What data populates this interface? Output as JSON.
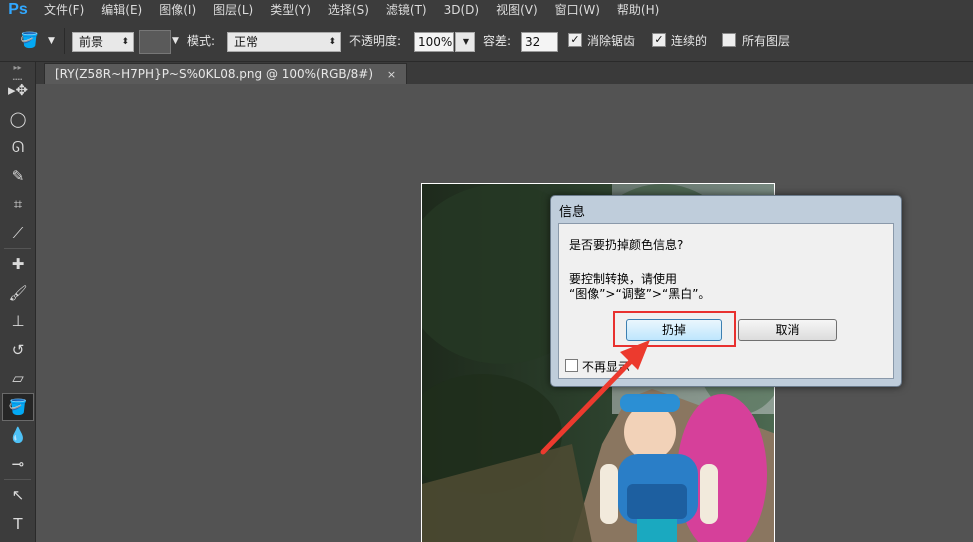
{
  "app": {
    "logo": "Ps",
    "accent": "#31a8ff"
  },
  "menu": [
    "文件(F)",
    "编辑(E)",
    "图像(I)",
    "图层(L)",
    "类型(Y)",
    "选择(S)",
    "滤镜(T)",
    "3D(D)",
    "视图(V)",
    "窗口(W)",
    "帮助(H)"
  ],
  "options": {
    "tool_icon": "paint-bucket-icon",
    "fill_source": "前景",
    "mode_label": "模式:",
    "mode_value": "正常",
    "opacity_label": "不透明度:",
    "opacity_value": "100%",
    "tolerance_label": "容差:",
    "tolerance_value": "32",
    "antialias_label": "消除锯齿",
    "antialias_checked": true,
    "contiguous_label": "连续的",
    "contiguous_checked": true,
    "all_layers_label": "所有图层",
    "all_layers_checked": false
  },
  "document_tab": {
    "title": "[RY(Z58R~H7PH}P~S%0KL08.png @ 100%(RGB/8#)",
    "close": "×"
  },
  "tools": [
    "move-icon",
    "ellipse-marquee-icon",
    "lasso-icon",
    "quick-select-icon",
    "crop-icon",
    "eyedropper-icon",
    "healing-brush-icon",
    "brush-icon",
    "clone-stamp-icon",
    "history-brush-icon",
    "eraser-icon",
    "paint-bucket-icon",
    "blur-icon",
    "dodge-icon",
    "path-select-icon",
    "type-icon"
  ],
  "active_tool": "paint-bucket-icon",
  "dialog": {
    "title": "信息",
    "question": "是否要扔掉颜色信息?",
    "line1": "要控制转换，请使用",
    "line2": "“图像”>“调整”>“黑白”。",
    "discard_button": "扔掉",
    "cancel_button": "取消",
    "dont_show_label": "不再显示",
    "dont_show_checked": false,
    "highlight_color": "#e8312f"
  }
}
